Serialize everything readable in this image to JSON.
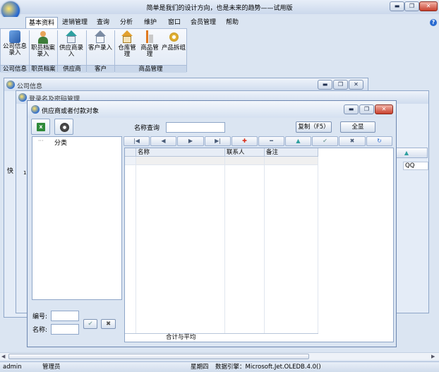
{
  "app": {
    "title": "简单是我们的设计方向，也是未来的趋势——试用版"
  },
  "menu": [
    "基本资料",
    "进销管理",
    "查询",
    "分析",
    "维护",
    "窗口",
    "会员管理",
    "帮助"
  ],
  "ribbon": {
    "items": [
      "公司信息录入",
      "职员档案录入",
      "供应商录入",
      "客户录入",
      "仓库管理",
      "商品管理",
      "产品拆组"
    ],
    "groups": [
      "公司信息",
      "职员档案",
      "供应商",
      "客户",
      "商品管理"
    ]
  },
  "bg_windows": {
    "company": {
      "title": "公司信息"
    },
    "login": {
      "title": "登录名及密码管理"
    },
    "left_label": "快",
    "row_num": "1",
    "qq_header": "QQ"
  },
  "dialog": {
    "title": "供应商或者付款对象",
    "search_label": "名称查询",
    "search_value": "",
    "copy_button": "复制（F5）",
    "show_all_button": "全显",
    "tree_root": "分类",
    "tree_prefix": "···",
    "code_label": "编号:",
    "name_label": "名称:",
    "code_value": "",
    "name_value": "",
    "grid_headers": [
      "名称",
      "联系人",
      "备注"
    ],
    "footer_label": "合计与平均"
  },
  "nav_glyphs": [
    "|◀",
    "◀",
    "▶",
    "▶|",
    "✚",
    "━",
    "▲",
    "✔",
    "✖",
    "↻"
  ],
  "status": {
    "user": "admin",
    "role": "管理员",
    "weekday": "星期四",
    "engine": "数据引擎：Microsoft.Jet.OLEDB.4.0()"
  },
  "colors": {
    "accent": "#2a6bd1",
    "danger": "#d9311d",
    "teal": "#2fa0a0"
  }
}
